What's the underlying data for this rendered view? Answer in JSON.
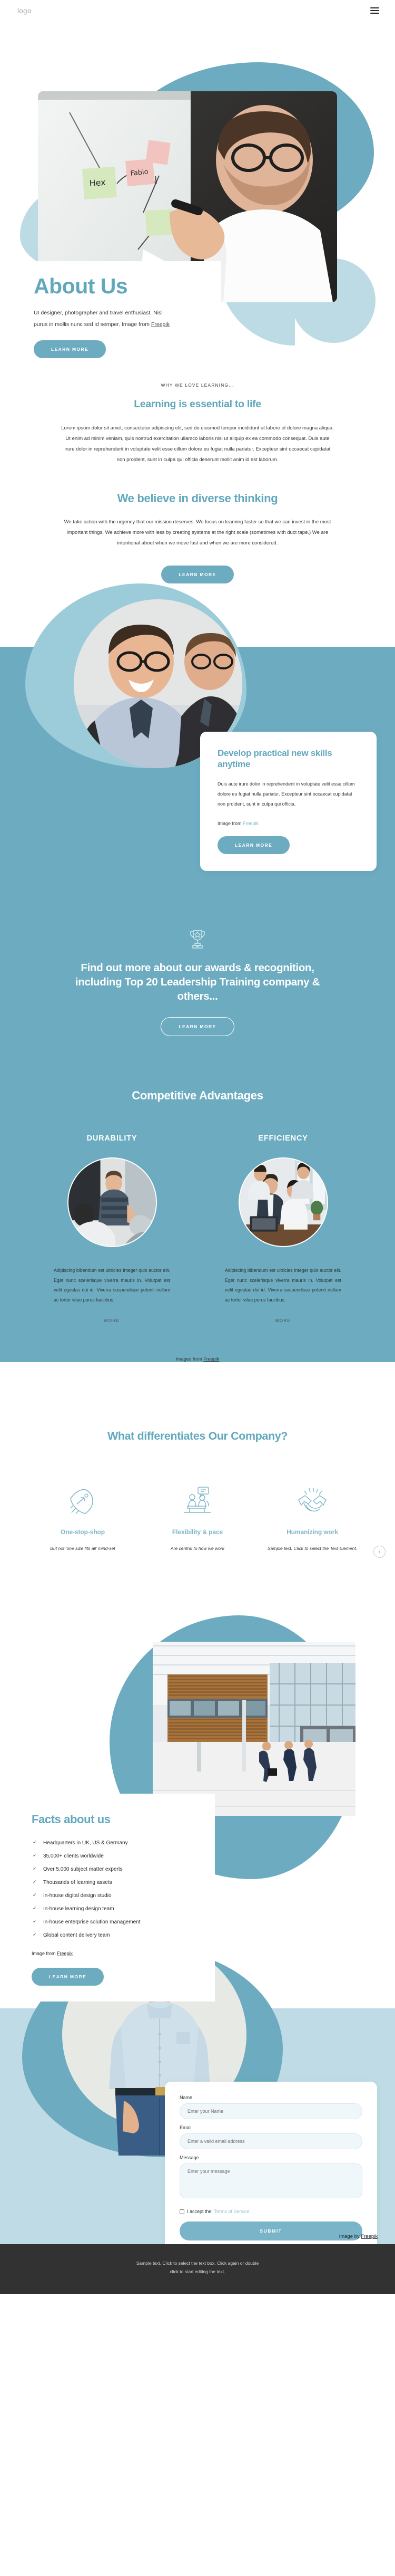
{
  "header": {
    "logo": "logo",
    "menu_icon": "hamburger-menu-icon"
  },
  "hero": {
    "title": "About Us",
    "description_1": "UI designer, photographer and travel enthusiast. Nisl purus in mollis nunc sed id semper.  Image from ",
    "credit_link": "Freepik",
    "button": "LEARN MORE"
  },
  "learning": {
    "eyebrow": "WHY WE LOVE LEARNING...",
    "heading_1": "Learning is essential to life",
    "body_1": "Lorem ipsum dolor sit amet, consectetur adipiscing elit, sed do eiusmod tempor incididunt ut labore et dolore magna aliqua. Ut enim ad minim veniam, quis nostrud exercitation ullamco laboris nisi ut aliquip ex ea commodo consequat. Duis aute irure dolor in reprehenderit in voluptate velit esse cillum dolore eu fugiat nulla pariatur. Excepteur sint occaecat cupidatat non proident, sunt in culpa qui officia deserunt mollit anim id est laborum.",
    "heading_2": "We believe in diverse thinking",
    "body_2": "We take action with the urgency that our mission deserves. We focus on learning faster so that we can invest in the most important things. We achieve more with less by creating systems at the right scale (sometimes with duct tape.) We are intentional about when we move fast and when we are more considered.",
    "button": "LEARN MORE"
  },
  "skills": {
    "heading": "Develop practical new skills anytime",
    "body": "Duis aute irure dolor in reprehenderit in voluptate velit esse cillum dolore eu fugiat nulla pariatur. Excepteur sint occaecat cupidatat non proident, sunt in culpa qui officia.",
    "credit_prefix": "Image from ",
    "credit_link": "Freepik",
    "button": "LEARN MORE"
  },
  "awards": {
    "icon": "trophy-icon",
    "heading": "Find out more about our awards & recognition, including Top 20 Leadership Training company & others...",
    "button": "LEARN MORE"
  },
  "advantages": {
    "heading": "Competitive Advantages",
    "items": [
      {
        "title": "DURABILITY",
        "body": "Adipiscing bibendum est ultricies integer quis auctor elit. Eget nunc scelerisque viverra mauris in. Volutpat est velit egestas dui id. Viverra suspendisse potenti nullam ac tortor vitae purus faucibus.",
        "link": "MORE"
      },
      {
        "title": "EFFICIENCY",
        "body": "Adipiscing bibendum est ultricies integer quis auctor elit. Eget nunc scelerisque viverra mauris in. Volutpat est velit egestas dui id. Viverra suspendisse potenti nullam ac tortor vitae purus faucibus.",
        "link": "MORE"
      }
    ],
    "credit_prefix": "Images from ",
    "credit_link": "Freepik"
  },
  "differentiates": {
    "heading": "What differentiates Our Company?",
    "next_icon": "chevron-right-icon",
    "features": [
      {
        "icon": "rocket-icon",
        "title": "One-stop-shop",
        "body": "But not ‘one size fits all’ mind-set"
      },
      {
        "icon": "meeting-icon",
        "title": "Flexibility & pace",
        "body": "Are central to how we work"
      },
      {
        "icon": "handshake-icon",
        "title": "Humanizing work",
        "body": "Sample text. Click to select the Text Element."
      }
    ]
  },
  "facts": {
    "heading": "Facts about us",
    "items": [
      "Headquarters in UK, US & Germany",
      "35,000+ clients worldwide",
      "Over 5,000 subject matter experts",
      "Thousands of learning assets",
      "In-house digital design studio",
      "In-house learning design team",
      "In-house enterprise solution management",
      "Global content delivery team"
    ],
    "credit_prefix": "Image from ",
    "credit_link": "Freepik",
    "button": "LEARN MORE"
  },
  "contact": {
    "name_label": "Name",
    "name_placeholder": "Enter your Name",
    "email_label": "Email",
    "email_placeholder": "Enter a valid email address",
    "message_label": "Message",
    "message_placeholder": "Enter your message",
    "accept_text": "I accept the ",
    "terms_link": "Terms of Service",
    "submit": "SUBMIT",
    "credit_prefix": "Image by ",
    "credit_link": "Freepik"
  },
  "footer": {
    "line_1": "Sample text. Click to select the text box. Click again or double",
    "line_2": "click to start editing the text."
  },
  "colors": {
    "teal": "#6cabc0",
    "teal_text": "#62a8bd",
    "light_blue": "#bfdce6",
    "mid_blue": "#9ccbda",
    "footer_dark": "#323232"
  }
}
